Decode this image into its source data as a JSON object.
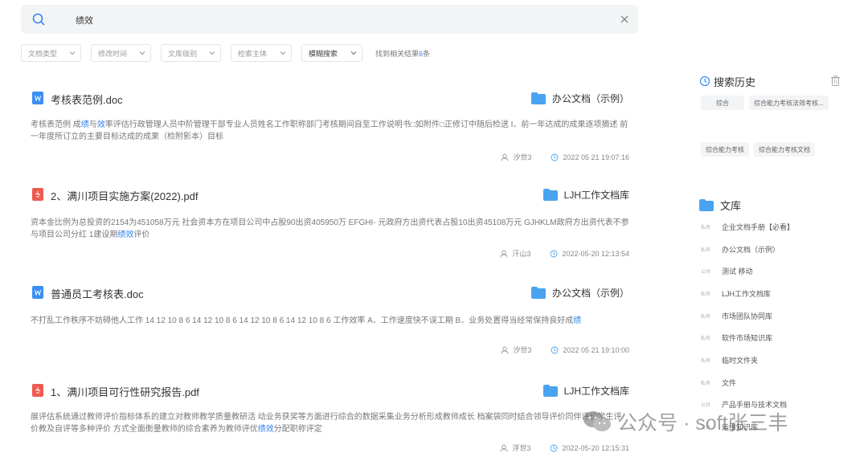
{
  "search": {
    "query": "绩效"
  },
  "filters": [
    {
      "label": "文档类型"
    },
    {
      "label": "修改时间"
    },
    {
      "label": "文库级别"
    },
    {
      "label": "检索主体"
    },
    {
      "label": "模糊搜索"
    }
  ],
  "result_count": {
    "prefix": "找到相关结果",
    "count": "6",
    "suffix": "条"
  },
  "results": [
    {
      "icon": "doc-file-icon",
      "title": "考核表范例.doc",
      "library": "办公文档（示例）",
      "snippet_before": "考核表范例 成",
      "snippet_hl1": "绩",
      "snippet_mid1": "与",
      "snippet_hl2": "效",
      "snippet_after": "率评估行政管理人员中阶管理干部专业人员姓名工作职称部门考核期间自至工作说明书□如附件□正修订中随后检送 I．前一年达成的成果逐项摘述 前一年度所订立的主要目标达成的成果（检附影本）目标",
      "author": "汐世3",
      "time": "2022 05 21 19:07:16"
    },
    {
      "icon": "pdf-file-icon",
      "title": "2、满川项目实施方案(2022).pdf",
      "library": "LJH工作文档库",
      "snippet_before": "资本金比例为总投资的2154为451058万元 社会资本方在项目公司中占股90出资405950万 EFGHI- 元政府方出资代表占股10出资45108万元 GJHKLM政府方出资代表不参与项目公司分红 1建设期",
      "snippet_hl1": "绩效",
      "snippet_mid1": "",
      "snippet_hl2": "",
      "snippet_after": "评价",
      "author": "汗山3",
      "time": "2022-05-20 12:13:54"
    },
    {
      "icon": "doc-file-icon",
      "title": "普通员工考核表.doc",
      "library": "办公文档（示例）",
      "snippet_before": "不打乱工作秩序不妨碍他人工作 14 12 10 8 6 14 12 10 8 6 14 12 10 8 6 14 12 10 8 6 工作效率 A．工作速度快不误工期 B．业务处置得当经常保持良好成",
      "snippet_hl1": "绩",
      "snippet_mid1": "",
      "snippet_hl2": "",
      "snippet_after": "",
      "author": "汐世3",
      "time": "2022 05 21 19:10:00"
    },
    {
      "icon": "pdf-file-icon",
      "title": "1、满川项目可行性研究报告.pdf",
      "library": "LJH工作文档库",
      "snippet_before": "展评估系统通过教师评价指标体系的建立对教师教学质量教研活 动业务获奖等方面进行综合的数据采集业务分析形成教师成长 档案袋同时结合领导评价同伴评价学生评价教及自评等多种评价 方式全面衡量教师的综合素养为教师评优",
      "snippet_hl1": "绩效",
      "snippet_mid1": "",
      "snippet_hl2": "",
      "snippet_after": "分配职称评定",
      "author": "浮世3",
      "time": "2022-05-20 12:15:31"
    }
  ],
  "sidebar": {
    "history_title": "搜索历史",
    "history_tags": [
      "综合",
      "综合能力考核法效考核...",
      "综合能力考核",
      "综合能力考核文档"
    ],
    "library_title": "文库",
    "library_items": [
      {
        "badge": "私有",
        "name": "企业文档手册【必看】"
      },
      {
        "badge": "私有",
        "name": "办公文档（示例）"
      },
      {
        "badge": "公共",
        "name": "测试 移动"
      },
      {
        "badge": "私有",
        "name": "LJH工作文档库"
      },
      {
        "badge": "私有",
        "name": "市场团队协同库"
      },
      {
        "badge": "私有",
        "name": "软件市场知识库"
      },
      {
        "badge": "私有",
        "name": "临时文件夹"
      },
      {
        "badge": "私有",
        "name": "文件"
      },
      {
        "badge": "公共",
        "name": "产品手册与技术文档"
      },
      {
        "badge": "公共",
        "name": "运维知识库"
      }
    ]
  },
  "watermark": {
    "text": "公众号 · soft张三丰"
  },
  "colors": {
    "accent": "#3b86f7",
    "highlight": "#2f7fe8",
    "doc": "#3b8ff4",
    "pdf": "#ef5a4f",
    "folder": "#4aa3f0"
  }
}
